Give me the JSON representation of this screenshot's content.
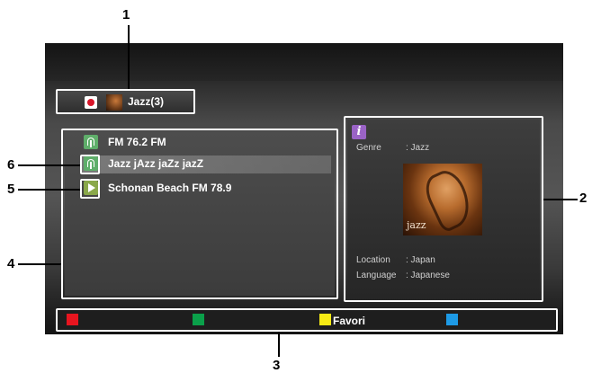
{
  "header": {
    "title": "Jazz(3)"
  },
  "station_list": [
    {
      "label": "FM 76.2 FM",
      "icon": "radio-icon"
    },
    {
      "label": "Jazz jAzz jaZz jazZ",
      "icon": "radio-icon",
      "selected": true
    },
    {
      "label": "Schonan Beach FM 78.9",
      "icon": "play-icon"
    }
  ],
  "info": {
    "genre_label": "Genre",
    "genre_value": ": Jazz",
    "album_caption": "jazz",
    "location_label": "Location",
    "location_value": ": Japan",
    "language_label": "Language",
    "language_value": ": Japanese"
  },
  "color_keys": {
    "red": "#e8151f",
    "green": "#0aa04a",
    "yellow": "#f6ea14",
    "blue": "#1d9ae6",
    "yellow_label": "Favori"
  },
  "callouts": [
    "1",
    "2",
    "3",
    "4",
    "5",
    "6"
  ]
}
